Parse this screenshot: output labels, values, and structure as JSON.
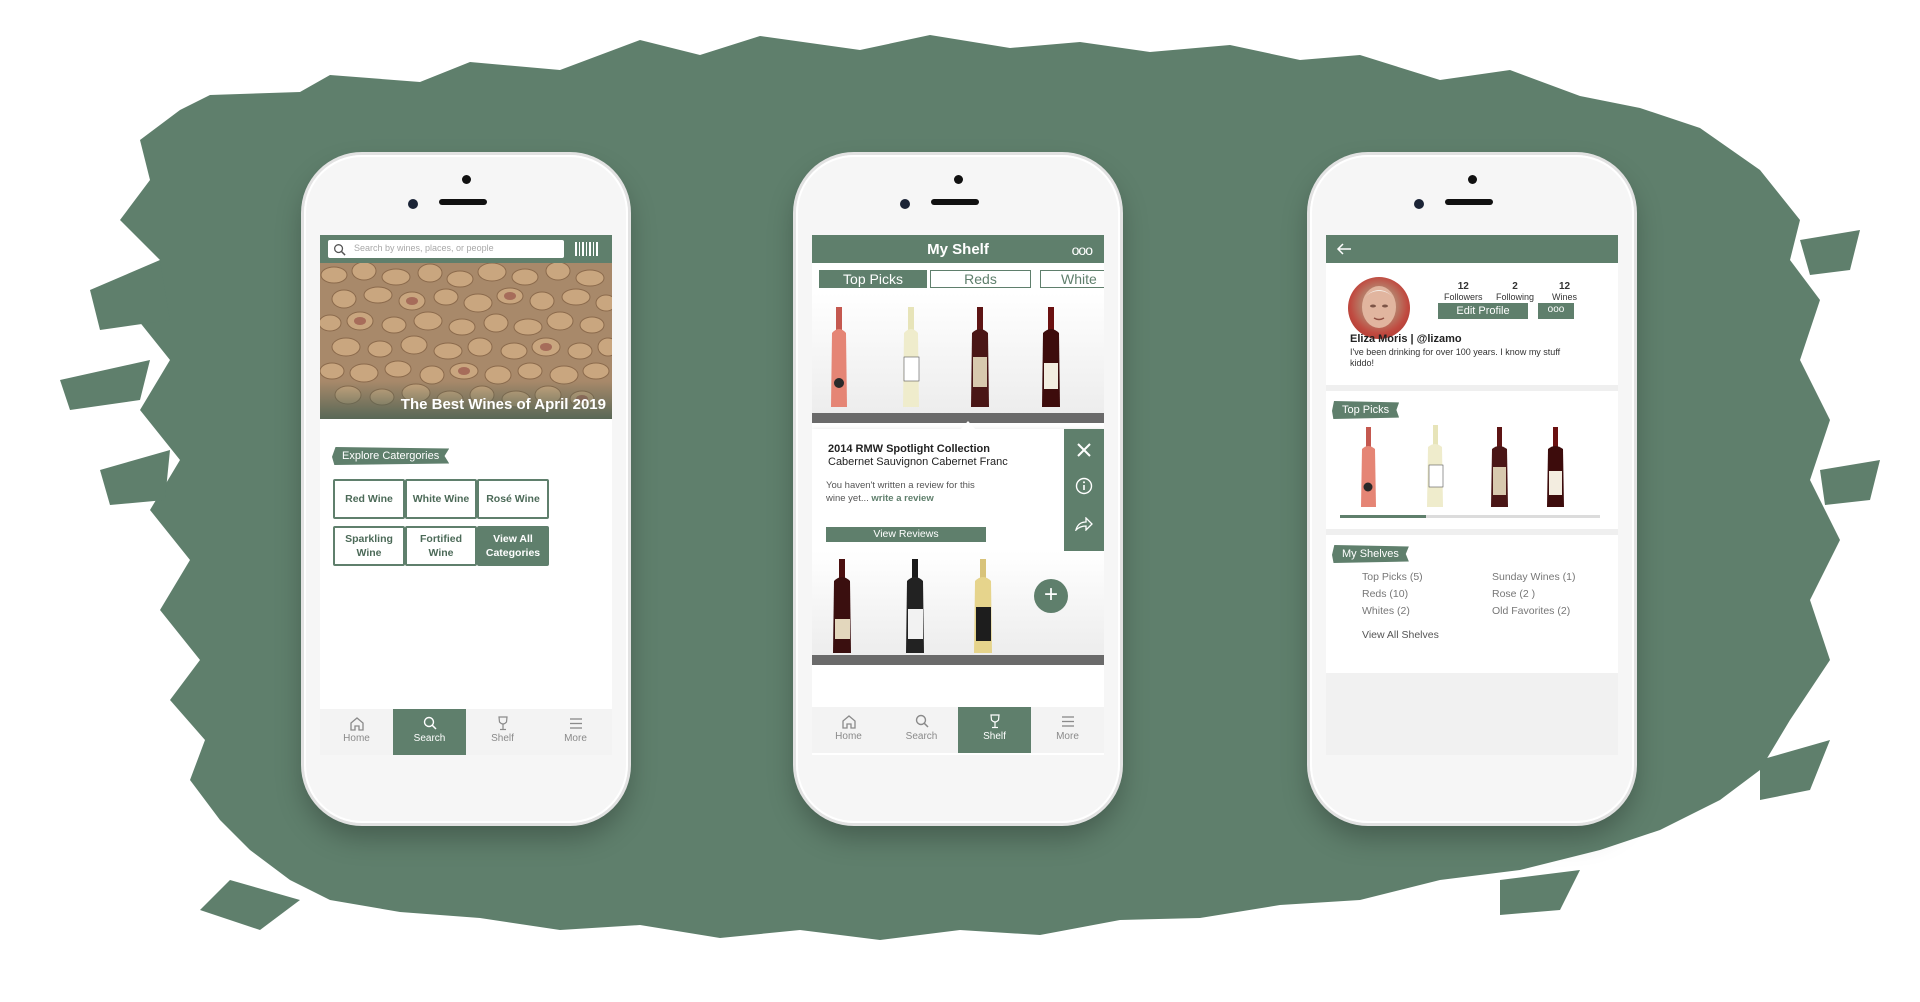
{
  "colors": {
    "accent": "#5f7f6c",
    "background": "#ffffff"
  },
  "search_screen": {
    "search_placeholder": "Search by wines, places, or people",
    "hero_title": "The Best Wines of April 2019",
    "explore_label": "Explore Catergories",
    "categories": [
      {
        "line1": "Red Wine",
        "line2": ""
      },
      {
        "line1": "White Wine",
        "line2": ""
      },
      {
        "line1": "Rosé Wine",
        "line2": ""
      },
      {
        "line1": "Sparkling",
        "line2": "Wine"
      },
      {
        "line1": "Fortified",
        "line2": "Wine"
      },
      {
        "line1": "View All",
        "line2": "Categories"
      }
    ],
    "tabs": [
      "Home",
      "Search",
      "Shelf",
      "More"
    ],
    "active_tab": "Search"
  },
  "shelf_screen": {
    "title": "My Shelf",
    "more_label": "ooo",
    "filters": [
      "Top Picks",
      "Reds",
      "White"
    ],
    "popup": {
      "wine_title": "2014 RMW Spotlight Collection",
      "wine_subtitle": "Cabernet Sauvignon Cabernet Franc",
      "review_prompt": "You haven't written a review for this wine yet...",
      "review_link": "write a review",
      "view_reviews": "View Reviews"
    },
    "add_label": "+",
    "tabs": [
      "Home",
      "Search",
      "Shelf",
      "More"
    ],
    "active_tab": "Shelf"
  },
  "profile_screen": {
    "stats": [
      {
        "value": "12",
        "label": "Followers"
      },
      {
        "value": "2",
        "label": "Following"
      },
      {
        "value": "12",
        "label": "Wines"
      }
    ],
    "edit_profile": "Edit Profile",
    "more_label": "ooo",
    "name": "Eliza Moris | @lizamo",
    "bio": "I've been drinking for over 100 years. I know my stuff kiddo!",
    "top_picks_label": "Top Picks",
    "top_picks_scroll_fraction": 0.33,
    "my_shelves_label": "My Shelves",
    "shelves_left": [
      "Top Picks (5)",
      "Reds (10)",
      "Whites (2)"
    ],
    "shelves_right": [
      "Sunday Wines (1)",
      "Rose (2 )",
      "Old Favorites (2)"
    ],
    "view_all_shelves": "View All Shelves"
  }
}
